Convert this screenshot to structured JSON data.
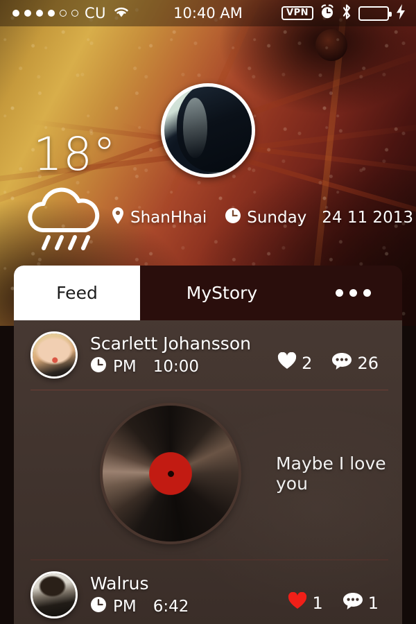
{
  "status_bar": {
    "signal_filled": 4,
    "signal_empty": 2,
    "carrier": "CU",
    "wifi_icon": "wifi-icon",
    "time": "10:40 AM",
    "vpn_label": "VPN",
    "alarm_icon": "alarm-clock-icon",
    "bluetooth_icon": "bluetooth-icon",
    "battery_level_percent": 15,
    "charging_icon": "lightning-bolt-icon"
  },
  "header": {
    "temperature": "18°",
    "weather_icon": "rain-cloud-icon",
    "location_icon": "location-pin-icon",
    "location": "ShanHhai",
    "clock_icon": "clock-icon",
    "day": "Sunday",
    "date": "24 11 2013",
    "avatar_name": "profile-avatar"
  },
  "tabs": [
    {
      "label": "Feed",
      "active": true
    },
    {
      "label": "MyStory",
      "active": false
    }
  ],
  "more_menu": {
    "icon": "ellipsis-icon",
    "dots": 3
  },
  "feed": {
    "posts": [
      {
        "author": "Scarlett Johansson",
        "clock_icon": "clock-icon",
        "meridiem": "PM",
        "time": "10:00",
        "like_icon": "heart-icon",
        "likes": "2",
        "liked": false,
        "comment_icon": "comment-bubble-icon",
        "comments": "26",
        "media": {
          "type": "vinyl-record",
          "song_title": "Maybe I love you",
          "label_color": "#c21b12"
        }
      },
      {
        "author": "Walrus",
        "clock_icon": "clock-icon",
        "meridiem": "PM",
        "time": "6:42",
        "like_icon": "heart-icon",
        "likes": "1",
        "liked": true,
        "comment_icon": "comment-bubble-icon",
        "comments": "1"
      }
    ]
  },
  "colors": {
    "panel": "#41332d",
    "tabbar": "#2a0e0c",
    "accent_red": "#ee1b16",
    "liked_red": "#f01f18",
    "text_light": "#ffffff"
  }
}
